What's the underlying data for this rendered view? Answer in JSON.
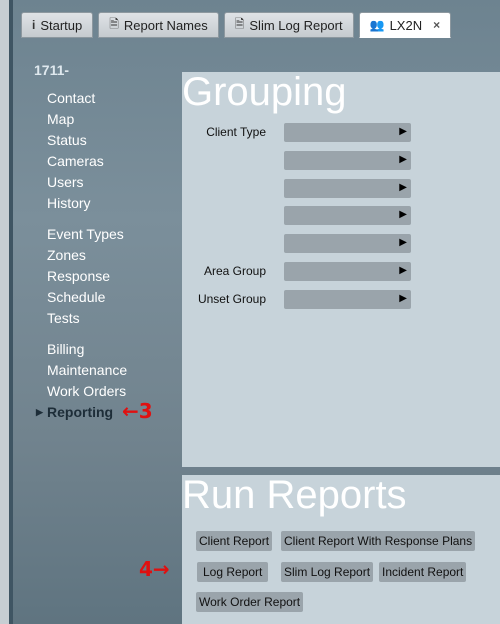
{
  "tabs": [
    {
      "label": "Startup",
      "icon": "info-icon"
    },
    {
      "label": "Report Names",
      "icon": "document-icon"
    },
    {
      "label": "Slim Log Report",
      "icon": "document-icon"
    },
    {
      "label": "LX2N",
      "icon": "users-icon",
      "close": "×",
      "active": true
    }
  ],
  "sidebar": {
    "account": "1711-",
    "group1": [
      "Contact",
      "Map",
      "Status",
      "Cameras",
      "Users",
      "History"
    ],
    "group2": [
      "Event Types",
      "Zones",
      "Response",
      "Schedule",
      "Tests"
    ],
    "group3": [
      "Billing",
      "Maintenance",
      "Work Orders"
    ],
    "selected": "Reporting"
  },
  "annotations": {
    "step3": "←3",
    "step4": "4→"
  },
  "grouping": {
    "title": "Grouping",
    "rows": [
      {
        "label": "Client Type"
      },
      {
        "label": ""
      },
      {
        "label": ""
      },
      {
        "label": ""
      },
      {
        "label": ""
      },
      {
        "label": "Area Group"
      },
      {
        "label": "Unset Group"
      }
    ]
  },
  "run_reports": {
    "title": "Run Reports",
    "buttons": [
      "Client Report",
      "Client Report With Response Plans",
      "Log Report",
      "Slim Log Report",
      "Incident Report",
      "Work Order Report"
    ]
  },
  "colors": {
    "accent_annotation": "#e01010",
    "panel": "#c7d3da",
    "frame": "#7b8f9b"
  }
}
